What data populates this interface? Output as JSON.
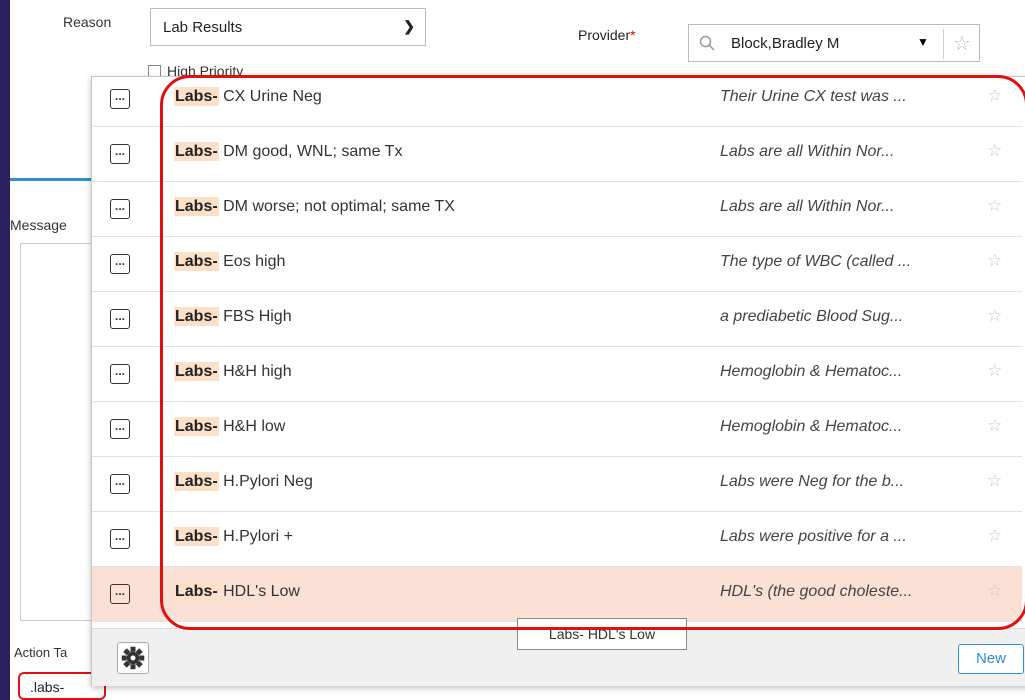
{
  "form": {
    "reason_label": "Reason",
    "reason_value": "Lab Results",
    "provider_label": "Provider",
    "provider_required": "*",
    "provider_value": "Block,Bradley M",
    "high_priority_label": "High Priority",
    "message_label": "Message",
    "action_label": "Action Ta",
    "tag_value": ".labs-"
  },
  "dropdown": {
    "rows": [
      {
        "prefix": "Labs-",
        "title": "CX Urine Neg",
        "desc": "Their Urine CX test was ..."
      },
      {
        "prefix": "Labs-",
        "title": "DM good, WNL; same Tx",
        "desc": "Labs are all Within Nor..."
      },
      {
        "prefix": "Labs-",
        "title": "DM worse; not optimal; same TX",
        "desc": "Labs are all Within Nor..."
      },
      {
        "prefix": "Labs-",
        "title": "Eos high",
        "desc": "The type of WBC (called ..."
      },
      {
        "prefix": "Labs-",
        "title": "FBS High",
        "desc": "a prediabetic Blood Sug..."
      },
      {
        "prefix": "Labs-",
        "title": "H&H high",
        "desc": "Hemoglobin & Hematoc..."
      },
      {
        "prefix": "Labs-",
        "title": "H&H low",
        "desc": "Hemoglobin & Hematoc..."
      },
      {
        "prefix": "Labs-",
        "title": "H.Pylori Neg",
        "desc": "Labs were Neg for the b..."
      },
      {
        "prefix": "Labs-",
        "title": "H.Pylori +",
        "desc": "Labs were positive for a ..."
      },
      {
        "prefix": "Labs-",
        "title": "HDL's Low",
        "desc": "HDL's (the good choleste..."
      }
    ],
    "tooltip": "Labs- HDL's Low",
    "new_label": "New"
  },
  "colors": {
    "accent": "#2e8fd6",
    "highlight": "#fce0c8",
    "selected_row": "#fbe0d5",
    "annotation": "#e01010"
  }
}
